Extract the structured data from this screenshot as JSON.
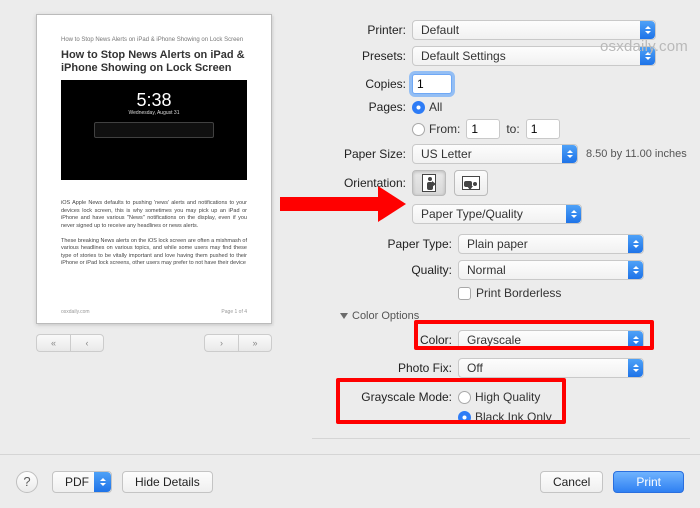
{
  "watermark": "osxdaily.com",
  "preview": {
    "breadcrumb": "How to Stop News Alerts on iPad & iPhone Showing on Lock Screen",
    "title": "How to Stop News Alerts on iPad & iPhone Showing on Lock Screen",
    "clock_time": "5:38",
    "clock_date": "Wednesday, August 31",
    "para1": "iOS Apple News defaults to pushing 'news' alerts and notifications to your devices lock screen, this is why sometimes you may pick up an iPad or iPhone and have various \"News\" notifications on the display, even if you never signed up to receive any headlines or news alerts.",
    "para2": "These breaking News alerts on the iOS lock screen are often a mishmash of various headlines on various topics, and while some users may find these type of stories to be vitally important and love having them pushed to their iPhone or iPad lock screens, other users may prefer to not have their device",
    "footer_left": "osxdaily.com",
    "footer_right": "Page 1 of 4"
  },
  "form": {
    "printer_label": "Printer:",
    "printer_value": "Default",
    "presets_label": "Presets:",
    "presets_value": "Default Settings",
    "copies_label": "Copies:",
    "copies_value": "1",
    "pages_label": "Pages:",
    "pages_all": "All",
    "pages_from_label": "From:",
    "pages_from_value": "1",
    "pages_to_label": "to:",
    "pages_to_value": "1",
    "papersize_label": "Paper Size:",
    "papersize_value": "US Letter",
    "papersize_dims": "8.50 by 11.00 inches",
    "orientation_label": "Orientation:",
    "section_value": "Paper Type/Quality",
    "papertype_label": "Paper Type:",
    "papertype_value": "Plain paper",
    "quality_label": "Quality:",
    "quality_value": "Normal",
    "borderless_label": "Print Borderless",
    "coloroptions_label": "Color Options",
    "color_label": "Color:",
    "color_value": "Grayscale",
    "photofix_label": "Photo Fix:",
    "photofix_value": "Off",
    "grayscale_label": "Grayscale Mode:",
    "grayscale_hq": "High Quality",
    "grayscale_blackink": "Black Ink Only"
  },
  "footer": {
    "help": "?",
    "pdf": "PDF",
    "hide": "Hide Details",
    "cancel": "Cancel",
    "print": "Print"
  },
  "icons": {
    "first": "«",
    "prev": "‹",
    "next": "›",
    "last": "»"
  }
}
